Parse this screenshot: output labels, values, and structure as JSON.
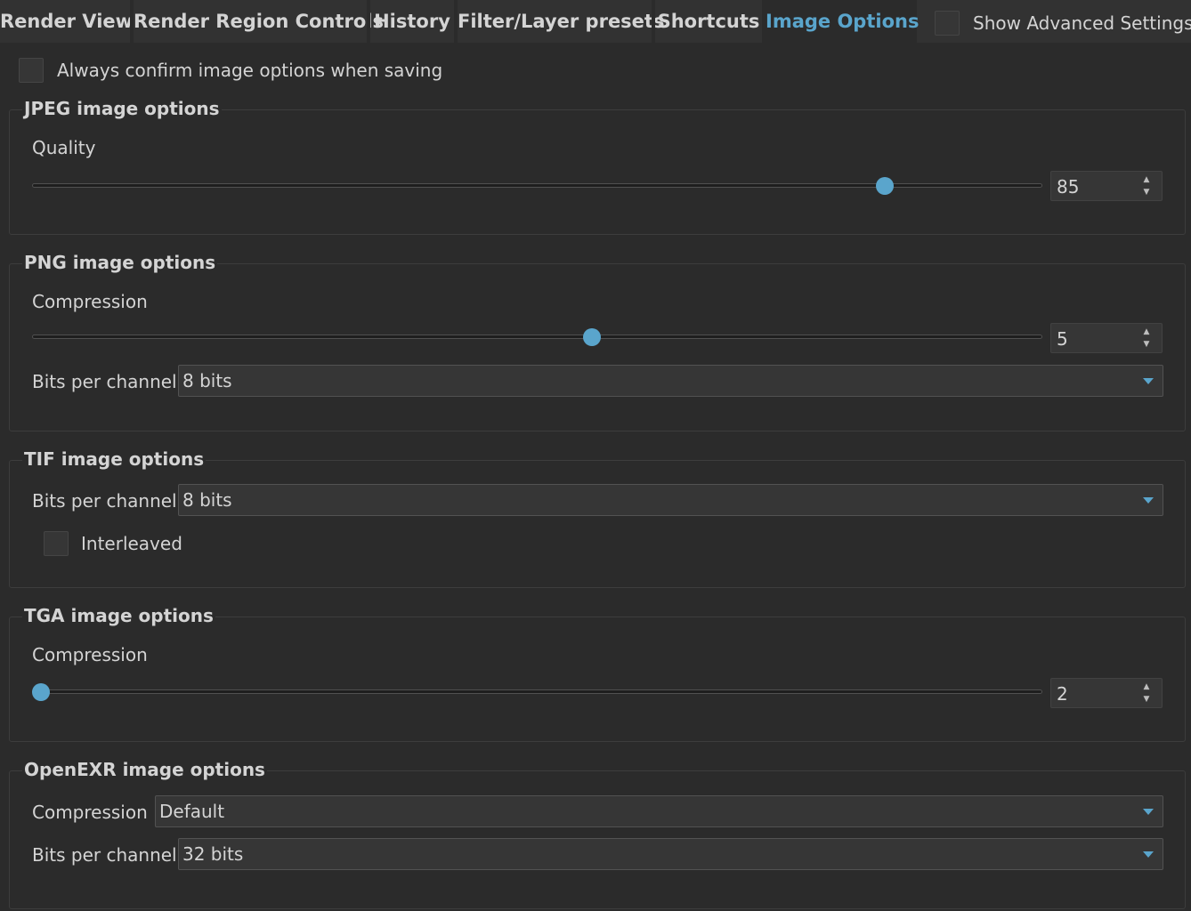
{
  "tabs": [
    {
      "label": "Render View"
    },
    {
      "label": "Render Region Controls"
    },
    {
      "label": "History"
    },
    {
      "label": "Filter/Layer presets"
    },
    {
      "label": "Shortcuts"
    },
    {
      "label": "Image Options"
    }
  ],
  "active_tab": "Image Options",
  "advanced": {
    "label": "Show Advanced Settings",
    "checked": false
  },
  "confirm": {
    "label": "Always confirm image options when saving",
    "checked": false
  },
  "jpeg": {
    "title": "JPEG image options",
    "quality_label": "Quality",
    "quality_value": "85",
    "quality_fraction": 0.85
  },
  "png": {
    "title": "PNG image options",
    "compression_label": "Compression",
    "compression_value": "5",
    "compression_fraction": 0.555,
    "bits_label": "Bits per channel",
    "bits_value": "8 bits"
  },
  "tif": {
    "title": "TIF image options",
    "bits_label": "Bits per channel",
    "bits_value": "8 bits",
    "interleaved_label": "Interleaved",
    "interleaved_checked": false
  },
  "tga": {
    "title": "TGA image options",
    "compression_label": "Compression",
    "compression_value": "2",
    "compression_fraction": 0.0
  },
  "exr": {
    "title": "OpenEXR image options",
    "compression_label": "Compression",
    "compression_value": "Default",
    "bits_label": "Bits per channel",
    "bits_value": "32 bits"
  },
  "colors": {
    "accent": "#5aa5cc",
    "background": "#2b2b2b",
    "tabbar": "#323232",
    "text": "#d4d4d4"
  }
}
